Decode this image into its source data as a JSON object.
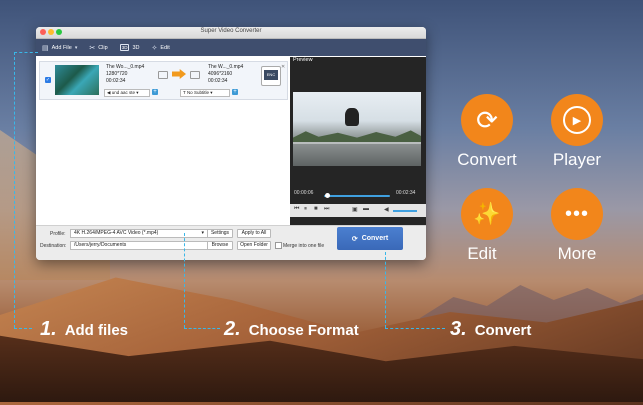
{
  "window": {
    "title": "Super Video Converter",
    "toolbar": {
      "add_file": "Add File",
      "clip": "Clip",
      "three_d": "3D",
      "three_d_badge": "3D",
      "edit": "Edit"
    }
  },
  "file_item": {
    "source_name": "The Wo..._0.mp4",
    "source_res": "1280*720",
    "source_duration": "00:02:34",
    "target_name": "The W..._0.mp4",
    "target_res": "4096*2160",
    "target_duration": "00:02:34",
    "audio_track": "und aac ste",
    "subtitle": "No Subtitle",
    "subtitle_prefix": "T",
    "encoder_badge": "ENC"
  },
  "preview": {
    "label": "Preview",
    "current_time": "00:00:06",
    "total_time": "00:02:34",
    "progress": 0.04,
    "volume": 0.8
  },
  "bottom": {
    "profile_label": "Profile:",
    "profile_value": "4K H.264/MPEG-4 AVC Video (*.mp4)",
    "settings": "Settings",
    "apply_all": "Apply to All",
    "destination_label": "Destination:",
    "destination_value": "/Users/jerry/Documents",
    "browse": "Browse",
    "open_folder": "Open Folder",
    "merge_label": "Merge into one file",
    "convert": "Convert"
  },
  "features": {
    "convert": "Convert",
    "player": "Player",
    "edit": "Edit",
    "more": "More"
  },
  "steps": [
    {
      "num": "1.",
      "text": "Add files"
    },
    {
      "num": "2.",
      "text": "Choose Format"
    },
    {
      "num": "3.",
      "text": "Convert"
    }
  ],
  "colors": {
    "accent_orange": "#f2861b",
    "dash_blue": "#39b7e8",
    "toolbar": "#3f4e6e",
    "convert_button": "#3a69b8"
  }
}
